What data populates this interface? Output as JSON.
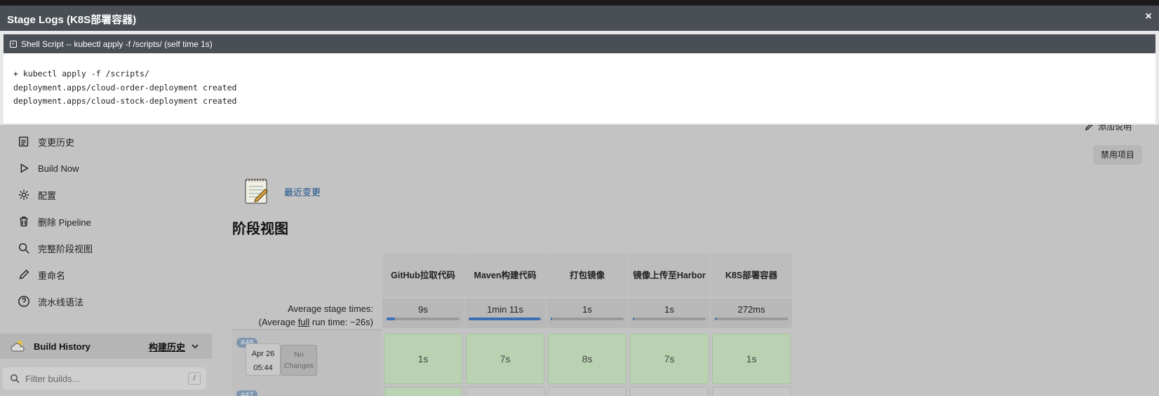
{
  "modal": {
    "title": "Stage Logs (K8S部署容器)",
    "close_icon": "×",
    "step_header": "Shell Script -- kubectl apply -f /scripts/ (self time 1s)",
    "console_lines": [
      "+ kubectl apply -f /scripts/",
      "deployment.apps/cloud-order-deployment created",
      "deployment.apps/cloud-stock-deployment created"
    ]
  },
  "sidebar": {
    "items": [
      {
        "label": "变更历史",
        "icon": "notepad-icon"
      },
      {
        "label": "Build Now",
        "icon": "play-icon"
      },
      {
        "label": "配置",
        "icon": "gear-icon"
      },
      {
        "label": "删除 Pipeline",
        "icon": "trash-icon"
      },
      {
        "label": "完整阶段视图",
        "icon": "search-icon"
      },
      {
        "label": "重命名",
        "icon": "pencil-icon"
      },
      {
        "label": "流水线语法",
        "icon": "help-icon"
      }
    ],
    "build_history": {
      "title": "Build History",
      "link": "构建历史",
      "filter_placeholder": "Filter builds...",
      "shortcut": "/"
    }
  },
  "actions": {
    "add_description": "添加说明",
    "disable_project": "禁用项目"
  },
  "main": {
    "recent_changes": "最近变更",
    "stage_view_title": "阶段视图",
    "avg_label": "Average stage times:",
    "avg_full_prefix": "(Average ",
    "avg_full_link": "full",
    "avg_full_suffix": " run time: ~26s)"
  },
  "stages": [
    {
      "name": "GitHub拉取代码",
      "avg": "9s",
      "bar_fraction": 0.12,
      "run48": "1s"
    },
    {
      "name": "Maven构建代码",
      "avg": "1min 11s",
      "bar_fraction": 0.98,
      "run48": "7s"
    },
    {
      "name": "打包镜像",
      "avg": "1s",
      "bar_fraction": 0.01,
      "run48": "8s"
    },
    {
      "name": "镜像上传至Harbor",
      "avg": "1s",
      "bar_fraction": 0.01,
      "run48": "7s"
    },
    {
      "name": "K8S部署容器",
      "avg": "272ms",
      "bar_fraction": 0.005,
      "run48": "1s"
    }
  ],
  "runs": [
    {
      "number": "#48",
      "date": "Apr 26",
      "time": "05:44",
      "changes": "No Changes"
    },
    {
      "number": "#47"
    }
  ],
  "colors": {
    "modal_header": "#4a4f55",
    "success_cell": "#b9d3b2",
    "link": "#1a4f8a",
    "progress": "#3a6fb5"
  }
}
